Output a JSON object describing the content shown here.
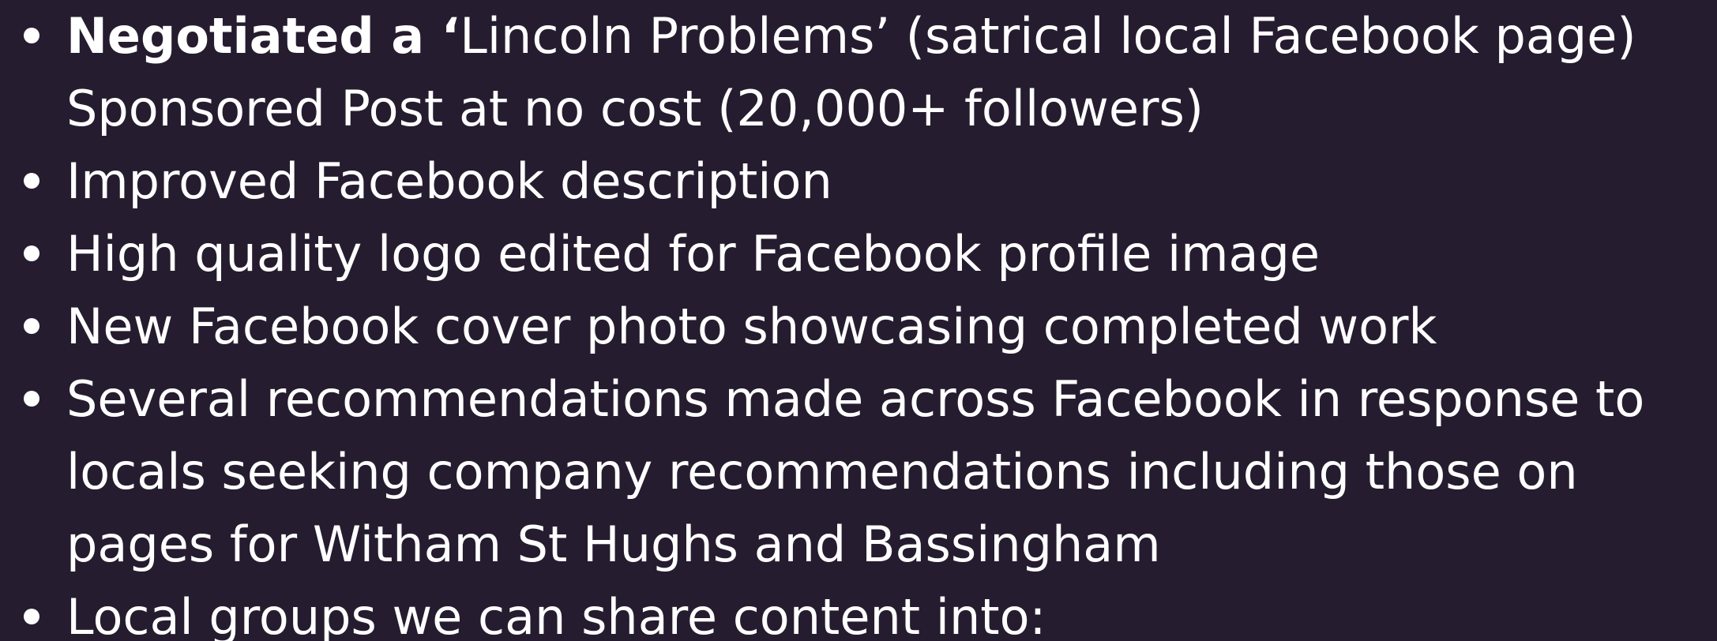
{
  "bullets": [
    {
      "lead": "Negotiated a ‘",
      "lines": [
        "Lincoln Problems’ (satrical local Facebook page)",
        "Sponsored Post at no cost (20,000+ followers)"
      ]
    },
    {
      "lines": [
        "Improved Facebook description"
      ]
    },
    {
      "lines": [
        "High quality logo edited for Facebook profile image"
      ]
    },
    {
      "lines": [
        "New Facebook cover photo showcasing completed work"
      ]
    },
    {
      "lines": [
        "Several recommendations made across Facebook in response to",
        "locals seeking company recommendations including those on",
        "pages for Witham St Hughs and Bassingham"
      ]
    },
    {
      "lines": [
        "Local groups we can share content into:"
      ]
    }
  ],
  "colors": {
    "background": "#261c2f",
    "text": "#ffffff"
  }
}
